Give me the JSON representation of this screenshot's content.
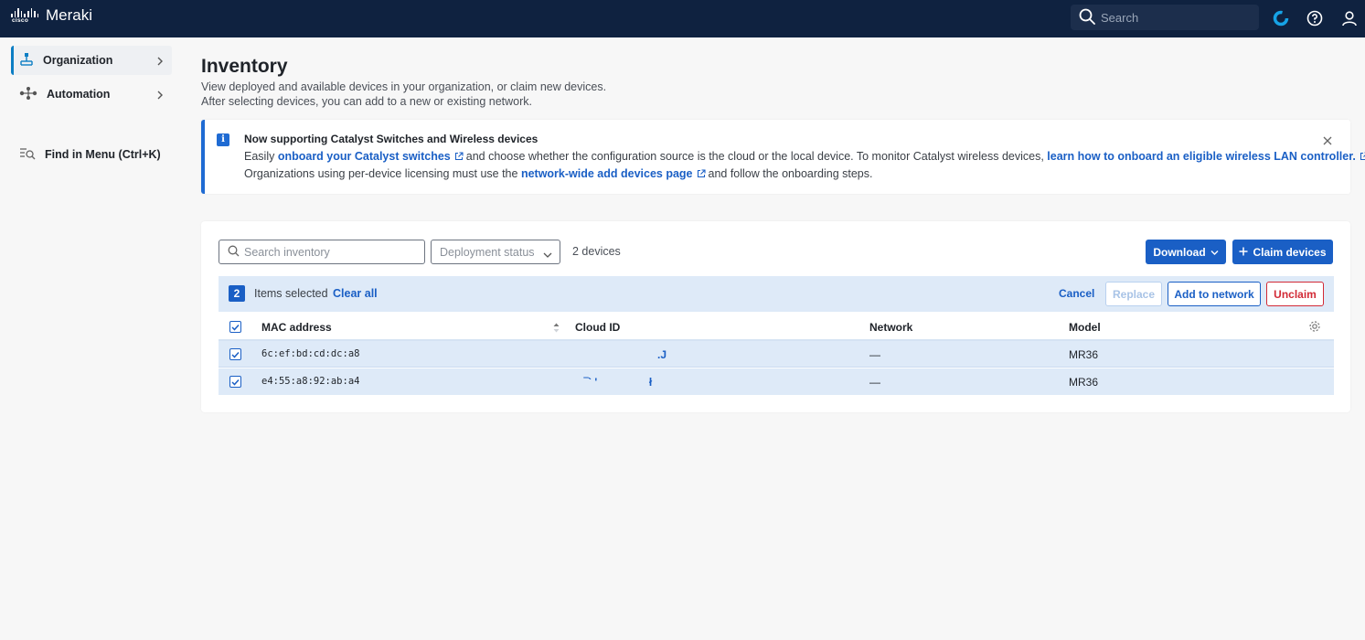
{
  "topbar": {
    "logo_text": "cisco",
    "app_name": "Meraki",
    "search_placeholder": "Search",
    "icons": [
      "search-icon",
      "status-ring-icon",
      "help-icon",
      "user-icon"
    ]
  },
  "sidebar": {
    "items": [
      {
        "label": "Organization",
        "icon": "org-chart-icon",
        "active": true
      },
      {
        "label": "Automation",
        "icon": "workflow-icon",
        "active": false
      }
    ],
    "find_menu": "Find in Menu (Ctrl+K)"
  },
  "header": {
    "title": "Inventory",
    "description": "View deployed and available devices in your organization, or claim new devices. After selecting devices, you can add to a new or existing network."
  },
  "banner": {
    "title": "Now supporting Catalyst Switches and Wireless devices",
    "line1_a": "Easily ",
    "line1_link1": "onboard your Catalyst switches",
    "line1_b": "and choose whether the configuration source is the cloud or the local device. To monitor Catalyst wireless devices, ",
    "line1_link2": "learn how to onboard an eligible wireless LAN controller.",
    "line2_a": "Organizations using per-device licensing must use the ",
    "line2_link": "network-wide add devices page",
    "line2_b": "and follow the onboarding steps."
  },
  "toolbar": {
    "search_placeholder": "Search inventory",
    "deployment_status_placeholder": "Deployment status",
    "device_count": "2 devices",
    "download_label": "Download",
    "claim_label": "Claim devices"
  },
  "selection": {
    "count": "2",
    "items_selected": "Items selected",
    "clear_all": "Clear all",
    "cancel": "Cancel",
    "replace": "Replace",
    "add_to_network": "Add to network",
    "unclaim": "Unclaim"
  },
  "table": {
    "columns": [
      "MAC address",
      "Cloud ID",
      "Network",
      "Model"
    ],
    "rows": [
      {
        "mac": "6c:ef:bd:cd:dc:a8",
        "cloud_id": ".J",
        "network": "—",
        "model": "MR36"
      },
      {
        "mac": "e4:55:a8:92:ab:a4",
        "cloud_id": "‾` '                 ł",
        "network": "—",
        "model": "MR36"
      }
    ]
  },
  "colors": {
    "topbar": "#0f2240",
    "accent": "#1a5fc5",
    "danger": "#d22a36",
    "selected_row": "#deeaf8"
  }
}
